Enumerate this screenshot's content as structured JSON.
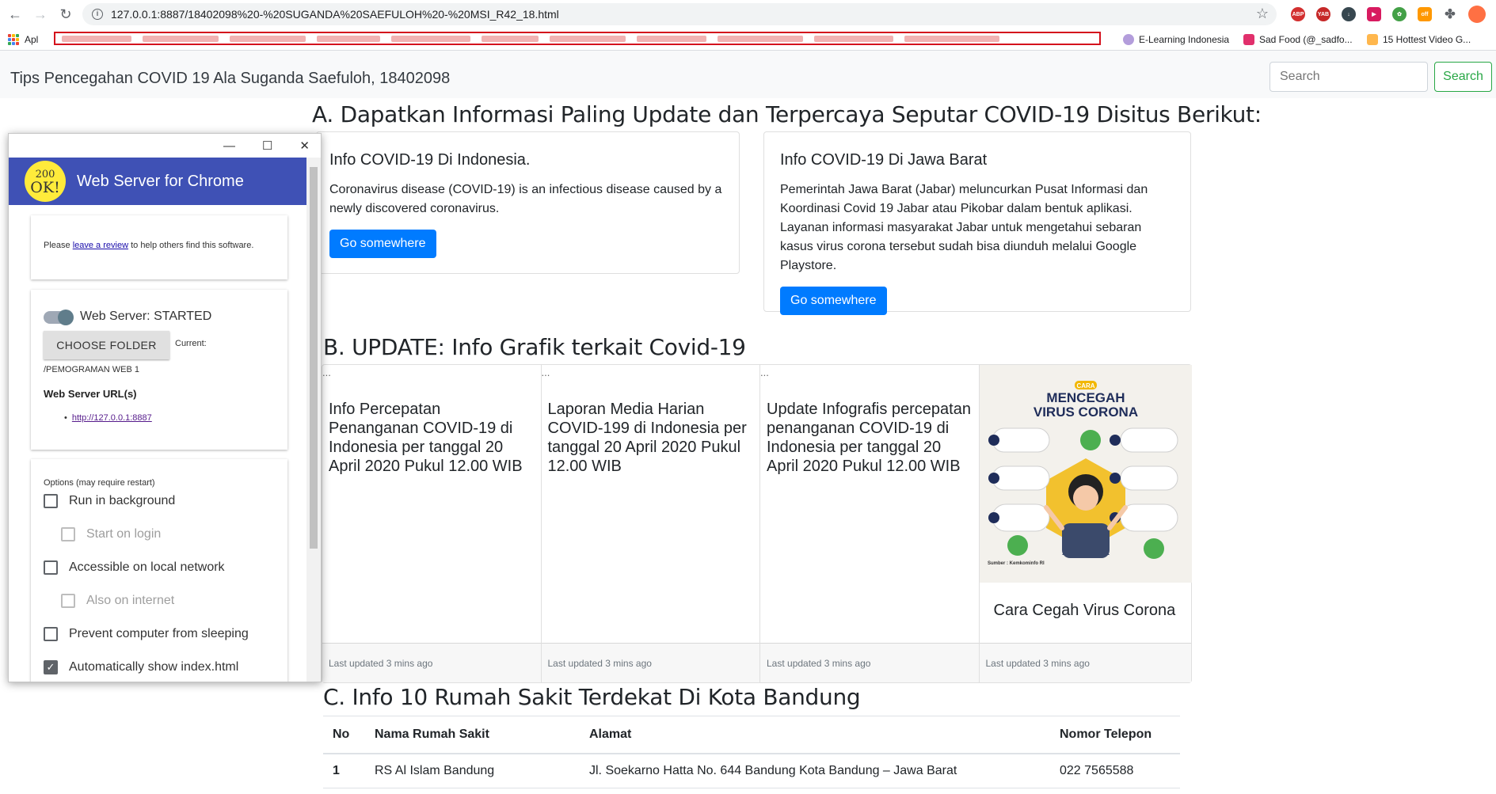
{
  "browser": {
    "url": "127.0.0.1:8887/18402098%20-%20SUGANDA%20SAEFULOH%20-%20MSI_R42_18.html",
    "bookmarks": [
      {
        "label": "Apl",
        "color": "#ea4335"
      },
      {
        "label": "E-Learning Indonesia",
        "color": "#9c27b0"
      },
      {
        "label": "Sad Food (@_sadfo...",
        "color": "#e1306c"
      },
      {
        "label": "15 Hottest Video G...",
        "color": "#ff9800"
      }
    ]
  },
  "navbar": {
    "brand": "Tips Pencegahan COVID 19 Ala Suganda Saefuloh, 18402098",
    "search_placeholder": "Search",
    "search_button": "Search"
  },
  "section_a": {
    "heading": "A. Dapatkan Informasi Paling Update dan Terpercaya Seputar COVID-19 Disitus Berikut:",
    "cards": [
      {
        "title": "Info COVID-19 Di Indonesia.",
        "text": "Coronavirus disease (COVID-19) is an infectious disease caused by a newly discovered coronavirus.",
        "button": "Go somewhere"
      },
      {
        "title": "Info COVID-19 Di Jawa Barat",
        "text": "Pemerintah Jawa Barat (Jabar) meluncurkan Pusat Informasi dan Koordinasi Covid 19 Jabar atau Pikobar dalam bentuk aplikasi. Layanan informasi masyarakat Jabar untuk mengetahui sebaran kasus virus corona tersebut sudah bisa diunduh melalui Google Playstore.",
        "button": "Go somewhere"
      }
    ]
  },
  "section_b": {
    "heading": "B. UPDATE: Info Grafik terkait Covid-19",
    "cards": [
      {
        "alt": "...",
        "title": "Info Percepatan Penanganan COVID-19 di Indonesia per tanggal 20 April 2020 Pukul 12.00 WIB",
        "footer": "Last updated 3 mins ago"
      },
      {
        "alt": "...",
        "title": "Laporan Media Harian COVID-199 di Indonesia per tanggal 20 April 2020 Pukul 12.00 WIB",
        "footer": "Last updated 3 mins ago"
      },
      {
        "alt": "...",
        "title": "Update Infografis percepatan penanganan COVID-19 di Indonesia per tanggal 20 April 2020 Pukul 12.00 WIB",
        "footer": "Last updated 3 mins ago"
      },
      {
        "title": "Cara Cegah Virus Corona",
        "footer": "Last updated 3 mins ago",
        "poster": {
          "tag": "CARA",
          "line1": "MENCEGAH",
          "line2": "VIRUS CORONA",
          "source": "Sumber : Kemkominfo RI"
        }
      }
    ]
  },
  "section_c": {
    "heading": "C. Info 10 Rumah Sakit Terdekat Di Kota Bandung",
    "columns": [
      "No",
      "Nama Rumah Sakit",
      "Alamat",
      "Nomor Telepon"
    ],
    "rows": [
      [
        "1",
        "RS Al Islam Bandung",
        "Jl. Soekarno Hatta No. 644 Bandung Kota Bandung – Jawa Barat",
        "022 7565588"
      ]
    ]
  },
  "web_server": {
    "title": "Web Server for Chrome",
    "logo_top": "200",
    "logo_bottom": "OK!",
    "review_prefix": "Please ",
    "review_link": "leave a review",
    "review_suffix": " to help others find this software.",
    "status": "Web Server: STARTED",
    "choose_folder": "CHOOSE FOLDER",
    "current_label": "Current:",
    "current_path": "/PEMOGRAMAN WEB 1",
    "urls_label": "Web Server URL(s)",
    "url": "http://127.0.0.1:8887",
    "options_label": "Options (may require restart)",
    "options": [
      {
        "label": "Run in background",
        "checked": false
      },
      {
        "label": "Start on login",
        "checked": false
      },
      {
        "label": "Accessible on local network",
        "checked": false
      },
      {
        "label": "Also on internet",
        "checked": false
      },
      {
        "label": "Prevent computer from sleeping",
        "checked": false
      },
      {
        "label": "Automatically show index.html",
        "checked": true
      }
    ]
  }
}
